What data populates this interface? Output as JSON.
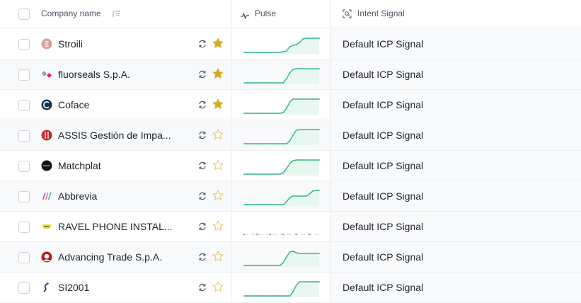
{
  "header": {
    "company_label": "Company name",
    "pulse_label": "Pulse",
    "intent_label": "Intent Signal"
  },
  "colors": {
    "star_filled": "#d6ac1e",
    "star_empty": "#e0c766",
    "spark_line": "#3cb88b"
  },
  "rows": [
    {
      "name": "Stroili",
      "logo": "stroili-logo",
      "starred": true,
      "intent": "Default ICP Signal",
      "pulse": [
        0,
        0,
        0,
        0,
        0,
        0,
        0,
        0,
        0,
        0,
        0,
        0,
        0.05,
        0.1,
        0.4,
        0.5,
        0.55,
        0.7,
        0.95,
        1,
        1,
        1,
        1,
        1
      ]
    },
    {
      "name": "fluorseals S.p.A.",
      "logo": "fluorseals-logo",
      "starred": true,
      "intent": "Default ICP Signal",
      "pulse": [
        0,
        0,
        0,
        0,
        0,
        0,
        0,
        0,
        0,
        0,
        0,
        0,
        0,
        0.3,
        0.7,
        0.95,
        1,
        1,
        1,
        1,
        1,
        1,
        1,
        1
      ]
    },
    {
      "name": "Coface",
      "logo": "coface-logo",
      "starred": true,
      "intent": "Default ICP Signal",
      "pulse": [
        0,
        0,
        0,
        0,
        0,
        0,
        0,
        0,
        0,
        0,
        0,
        0,
        0.05,
        0.35,
        0.8,
        1,
        1,
        1,
        1,
        1,
        1,
        1,
        1,
        1
      ]
    },
    {
      "name": "ASSIS Gestión de Impa...",
      "logo": "assis-logo",
      "starred": false,
      "intent": "Default ICP Signal",
      "pulse": [
        0,
        0,
        0,
        0,
        0,
        0,
        0,
        0,
        0,
        0,
        0,
        0,
        0,
        0,
        0.2,
        0.6,
        0.95,
        1,
        1,
        1,
        1,
        1,
        1,
        1
      ]
    },
    {
      "name": "Matchplat",
      "logo": "matchplat-logo",
      "starred": false,
      "intent": "Default ICP Signal",
      "pulse": [
        0,
        0,
        0,
        0,
        0,
        0,
        0,
        0,
        0,
        0,
        0,
        0,
        0.1,
        0.4,
        0.75,
        0.95,
        1,
        1,
        1,
        1,
        1,
        1,
        1,
        1
      ]
    },
    {
      "name": "Abbrevia",
      "logo": "abbrevia-logo",
      "starred": false,
      "intent": "Default ICP Signal",
      "pulse": [
        0,
        0,
        0,
        0,
        0,
        0,
        0,
        0,
        0,
        0,
        0,
        0,
        0,
        0.2,
        0.5,
        0.6,
        0.6,
        0.6,
        0.6,
        0.6,
        0.75,
        0.95,
        1,
        1
      ]
    },
    {
      "name": "RAVEL PHONE INSTAL...",
      "logo": "ravel-logo",
      "starred": false,
      "intent": "Default ICP Signal",
      "pulse": [
        0,
        0,
        0,
        0,
        0,
        0,
        0,
        0,
        0,
        0,
        0,
        0,
        0,
        0,
        0,
        0,
        0,
        0,
        0,
        0,
        0,
        0,
        0,
        0
      ]
    },
    {
      "name": "Advancing Trade S.p.A.",
      "logo": "advancing-logo",
      "starred": false,
      "intent": "Default ICP Signal",
      "pulse": [
        0,
        0,
        0,
        0,
        0,
        0,
        0,
        0,
        0,
        0,
        0,
        0,
        0.2,
        0.6,
        0.95,
        1,
        0.9,
        0.85,
        0.85,
        0.85,
        0.85,
        0.85,
        0.85,
        0.85
      ]
    },
    {
      "name": "SI2001",
      "logo": "si2001-logo",
      "starred": false,
      "intent": "Default ICP Signal",
      "pulse": [
        0,
        0,
        0,
        0,
        0,
        0,
        0,
        0,
        0,
        0,
        0,
        0,
        0,
        0,
        0,
        0.3,
        0.75,
        1,
        1,
        1,
        1,
        1,
        1,
        1
      ]
    }
  ]
}
